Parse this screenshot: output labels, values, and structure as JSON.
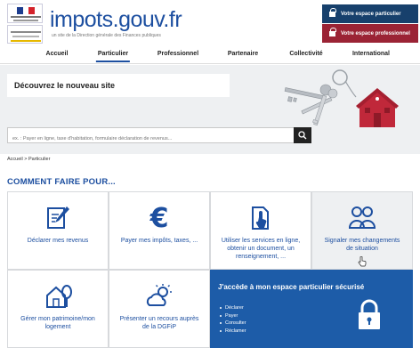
{
  "header": {
    "brand": "impots.gouv.fr",
    "tagline": "un site de la Direction générale des Finances publiques",
    "btn_particulier": "Votre espace particulier",
    "btn_professionnel": "Votre espace professionnel",
    "colors": {
      "navy": "#17406c",
      "red": "#9b2335",
      "blue": "#1d4fa0"
    }
  },
  "nav": {
    "items": [
      "Accueil",
      "Particulier",
      "Professionnel",
      "Partenaire",
      "Collectivité",
      "International"
    ],
    "active": "Particulier"
  },
  "hero": {
    "title": "Découvrez le nouveau site",
    "search_placeholder": "ex. : Payer en ligne, taxe d'habitation, formulaire déclaration de revenus..."
  },
  "breadcrumb": "Accueil > Particulier",
  "section_title": "COMMENT FAIRE POUR...",
  "tiles": [
    {
      "label": "Déclarer mes revenus",
      "icon": "pencil-document-icon"
    },
    {
      "label": "Payer mes impôts, taxes, ...",
      "icon": "euro-icon"
    },
    {
      "label": "Utiliser les services en ligne, obtenir un document, un renseignement, ...",
      "icon": "document-touch-icon"
    },
    {
      "label": "Signaler mes changements de situation",
      "icon": "people-icon"
    },
    {
      "label": "Gérer mon patrimoine/mon logement",
      "icon": "house-tree-icon"
    },
    {
      "label": "Présenter un recours auprès de la DGFiP",
      "icon": "weather-icon"
    }
  ],
  "secure_tile": {
    "title": "J'accède à mon espace particulier sécurisé",
    "items": [
      "Déclarer",
      "Payer",
      "Consulter",
      "Réclamer"
    ],
    "icon": "lock-icon"
  }
}
